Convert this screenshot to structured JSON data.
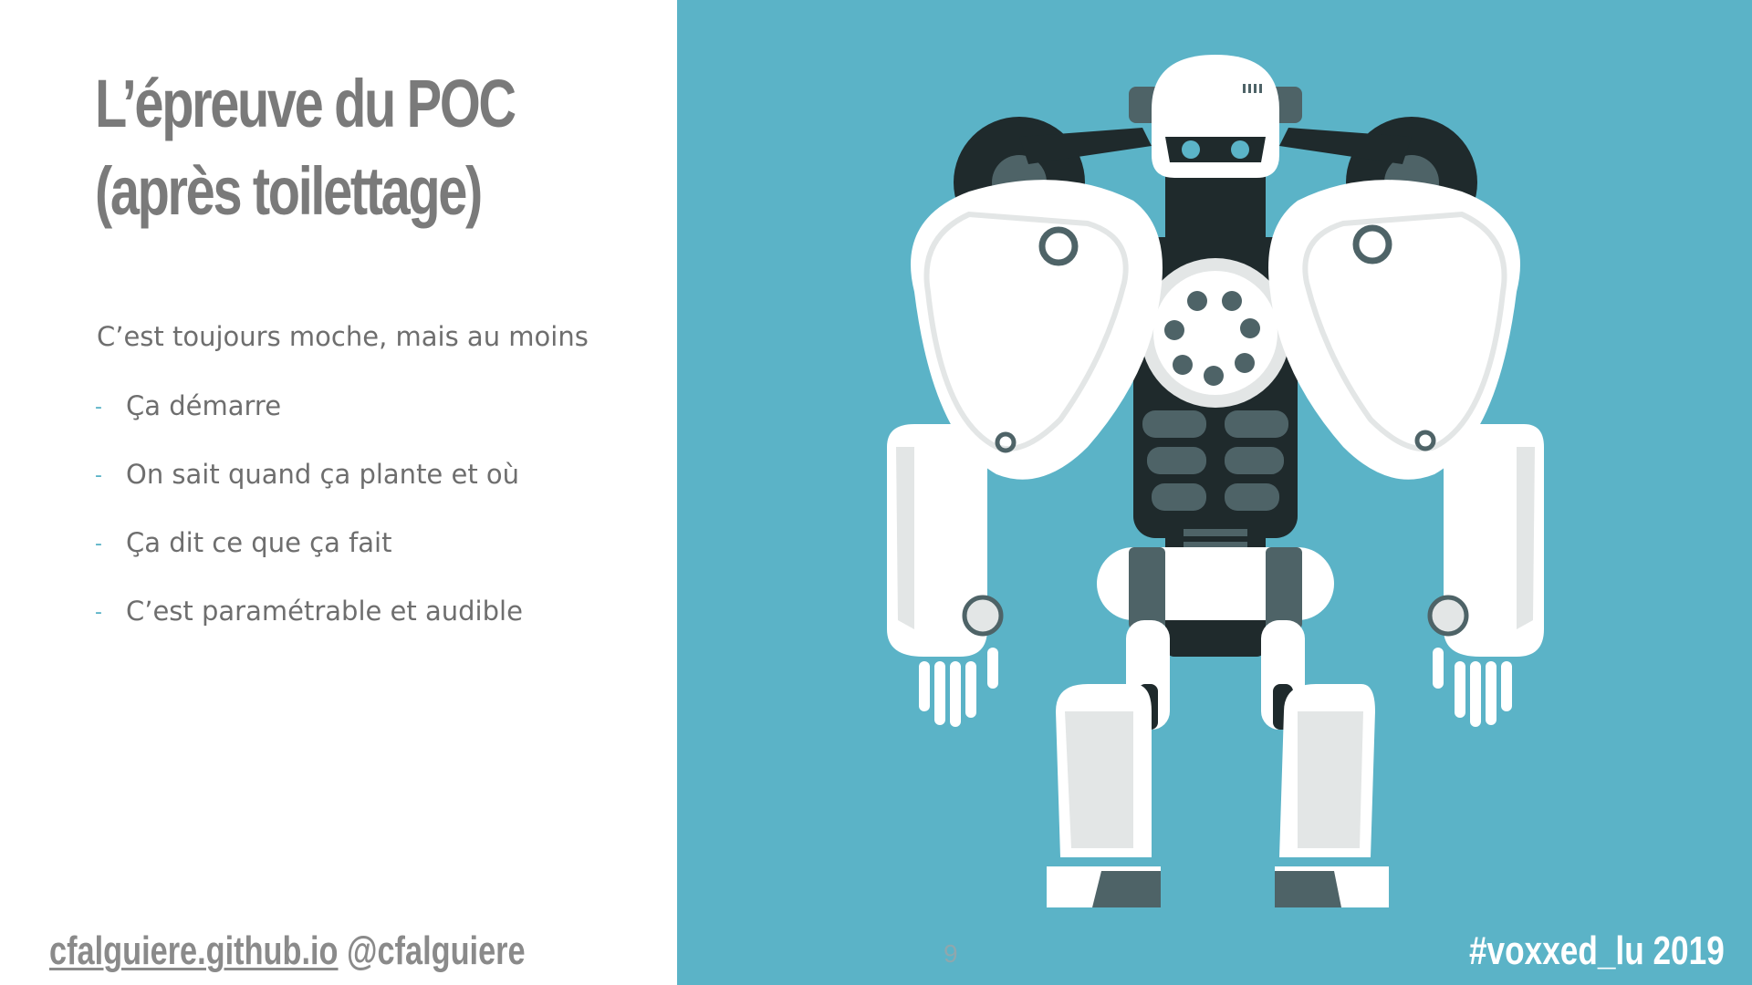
{
  "slide": {
    "title_line1": "L’épreuve du POC",
    "title_line2": "(après toilettage)",
    "intro": "C’est toujours moche, mais au moins",
    "bullet_marker": "-",
    "bullets": [
      "Ça démarre",
      "On sait quand ça plante et où",
      "Ça dit ce que ça fait",
      "C’est paramétrable et audible"
    ],
    "page_number": "9"
  },
  "footer": {
    "site": "cfalguiere.github.io",
    "handle": "@cfalguiere",
    "hashtag": "#voxxed_lu 2019"
  },
  "illustration": {
    "subject": "robot-illustration",
    "colors": {
      "background": "#5bb3c7",
      "white": "#ffffff",
      "light_gray": "#e3e6e6",
      "dark": "#1f2a2c",
      "slate": "#4e6367",
      "text_gray": "#7a7a7a",
      "accent_dash": "#58b2c6"
    }
  }
}
